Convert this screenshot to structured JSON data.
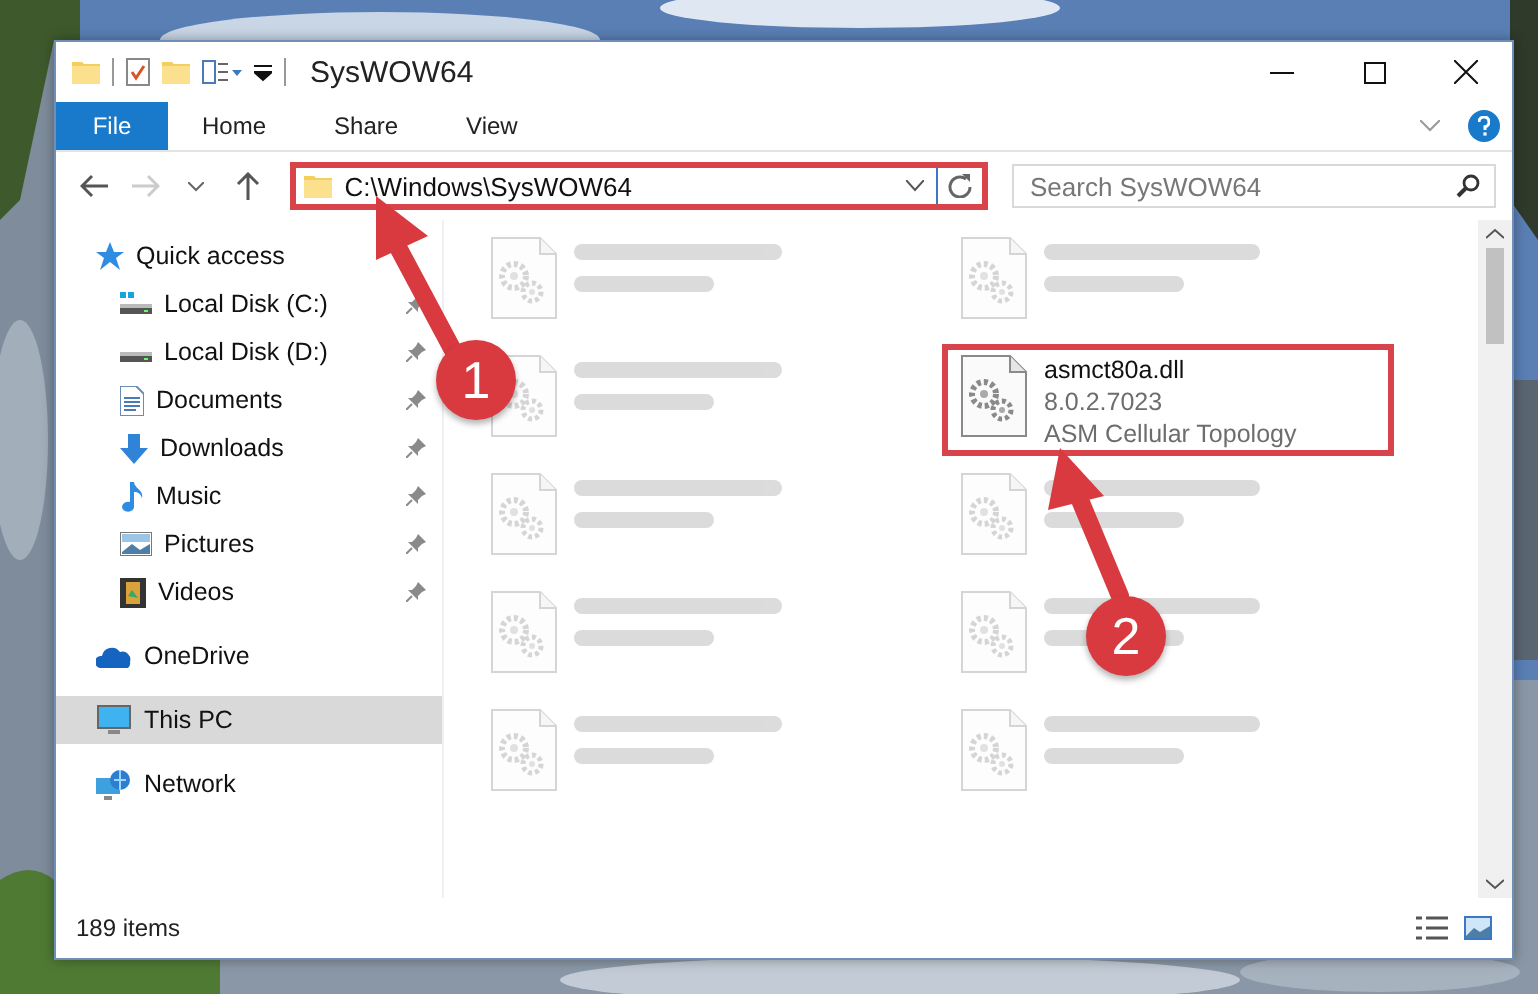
{
  "window": {
    "title": "SysWOW64"
  },
  "ribbon": {
    "tabs": [
      {
        "label": "File",
        "kind": "file"
      },
      {
        "label": "Home",
        "kind": "tab"
      },
      {
        "label": "Share",
        "kind": "tab"
      },
      {
        "label": "View",
        "kind": "tab"
      }
    ]
  },
  "navigation": {
    "back_disabled": false,
    "forward_disabled": true
  },
  "address": {
    "value": "C:\\Windows\\SysWOW64",
    "highlighted": true
  },
  "search": {
    "placeholder": "Search SysWOW64"
  },
  "sidebar": {
    "items": [
      {
        "label": "Quick access",
        "kind": "star",
        "selected": false,
        "children": [
          {
            "label": "Local Disk (C:)",
            "kind": "system-drive",
            "pinned": true,
            "selected": false
          },
          {
            "label": "Local Disk (D:)",
            "kind": "drive",
            "pinned": true,
            "selected": false
          },
          {
            "label": "Documents",
            "kind": "documents",
            "pinned": true,
            "selected": false
          },
          {
            "label": "Downloads",
            "kind": "downloads",
            "pinned": true,
            "selected": false
          },
          {
            "label": "Music",
            "kind": "music",
            "pinned": true,
            "selected": false
          },
          {
            "label": "Pictures",
            "kind": "pictures",
            "pinned": true,
            "selected": false
          },
          {
            "label": "Videos",
            "kind": "videos",
            "pinned": true,
            "selected": false
          }
        ]
      },
      {
        "label": "OneDrive",
        "kind": "cloud",
        "selected": false
      },
      {
        "label": "This PC",
        "kind": "computer",
        "selected": true
      },
      {
        "label": "Network",
        "kind": "network",
        "selected": false
      }
    ]
  },
  "files": [
    {
      "kind": "blurred"
    },
    {
      "kind": "blurred"
    },
    {
      "kind": "blurred"
    },
    {
      "kind": "file",
      "name": "asmct80a.dll",
      "details": [
        "8.0.2.7023",
        "ASM Cellular Topology"
      ],
      "highlighted": true
    },
    {
      "kind": "blurred"
    },
    {
      "kind": "blurred"
    },
    {
      "kind": "blurred"
    },
    {
      "kind": "blurred"
    },
    {
      "kind": "blurred"
    },
    {
      "kind": "blurred"
    }
  ],
  "status_bar": {
    "item_count": "189 items"
  },
  "annotations": [
    {
      "label": "1"
    },
    {
      "label": "2"
    }
  ]
}
